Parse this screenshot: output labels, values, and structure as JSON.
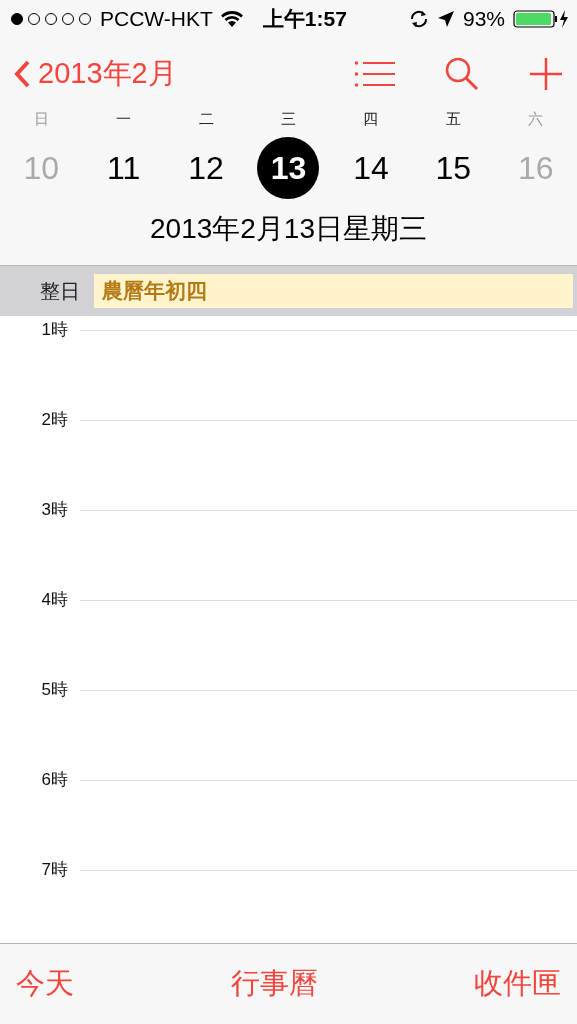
{
  "status_bar": {
    "carrier": "PCCW-HKT",
    "time": "上午1:57",
    "battery": "93%"
  },
  "nav": {
    "back": "2013年2月"
  },
  "week": [
    {
      "weekday": "日",
      "date": "10",
      "muted": true,
      "selected": false
    },
    {
      "weekday": "一",
      "date": "11",
      "muted": false,
      "selected": false
    },
    {
      "weekday": "二",
      "date": "12",
      "muted": false,
      "selected": false
    },
    {
      "weekday": "三",
      "date": "13",
      "muted": false,
      "selected": true
    },
    {
      "weekday": "四",
      "date": "14",
      "muted": false,
      "selected": false
    },
    {
      "weekday": "五",
      "date": "15",
      "muted": false,
      "selected": false
    },
    {
      "weekday": "六",
      "date": "16",
      "muted": true,
      "selected": false
    }
  ],
  "full_date": "2013年2月13日星期三",
  "all_day": {
    "label": "整日",
    "event": "農曆年初四"
  },
  "hours": [
    "1時",
    "2時",
    "3時",
    "4時",
    "5時",
    "6時",
    "7時"
  ],
  "tab_bar": [
    "今天",
    "行事曆",
    "收件匣"
  ]
}
